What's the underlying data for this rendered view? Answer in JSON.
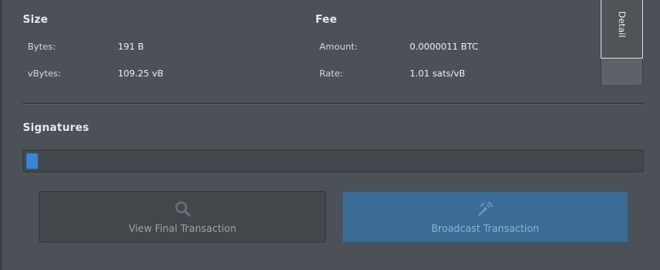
{
  "size_section": {
    "heading": "Size",
    "bytes_label": "Bytes:",
    "bytes_value": "191 B",
    "vbytes_label": "vBytes:",
    "vbytes_value": "109.25 vB"
  },
  "fee_section": {
    "heading": "Fee",
    "amount_label": "Amount:",
    "amount_value": "0.0000011 BTC",
    "rate_label": "Rate:",
    "rate_value": "1.01 sats/vB"
  },
  "side_tab": {
    "label": "Detail"
  },
  "signatures": {
    "heading": "Signatures",
    "progress_fraction": 0.02
  },
  "buttons": {
    "view_final": {
      "label": "View Final Transaction",
      "icon": "search-icon",
      "enabled": false
    },
    "broadcast": {
      "label": "Broadcast Transaction",
      "icon": "broadcast-icon",
      "enabled": false
    }
  },
  "colors": {
    "background": "#4c5157",
    "progress_fill": "#3b86cf",
    "broadcast_button": "#3a6c96",
    "view_button": "#43474c"
  }
}
